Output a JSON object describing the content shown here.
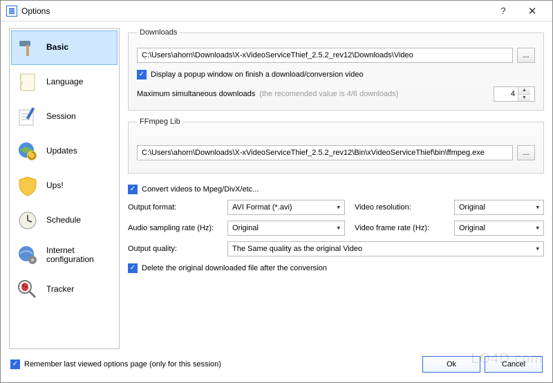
{
  "titlebar": {
    "title": "Options",
    "help": "?",
    "close": "✕"
  },
  "sidebar": {
    "items": [
      {
        "label": "Basic",
        "selected": true
      },
      {
        "label": "Language"
      },
      {
        "label": "Session"
      },
      {
        "label": "Updates"
      },
      {
        "label": "Ups!"
      },
      {
        "label": "Schedule"
      },
      {
        "label": "Internet\nconfiguration"
      },
      {
        "label": "Tracker"
      }
    ]
  },
  "downloads": {
    "legend": "Downloads",
    "path": "C:\\Users\\ahorn\\Downloads\\X-xVideoServiceThief_2.5.2_rev12\\Downloads\\Video",
    "browse": "...",
    "popup_label": "Display a popup window on finish a download/conversion video",
    "maxdl_label": "Maximum simultaneous downloads ",
    "maxdl_hint": "(the recomended value is 4/6 downloads)",
    "maxdl_value": "4"
  },
  "ffmpeg": {
    "legend": "FFmpeg Lib",
    "path": "C:\\Users\\ahorn\\Downloads\\X-xVideoServiceThief_2.5.2_rev12\\Bin\\xVideoServiceThief\\bin\\ffmpeg.exe",
    "browse": "..."
  },
  "convert": {
    "convert_label": "Convert videos to Mpeg/DivX/etc...",
    "output_format_label": "Output format:",
    "output_format_value": "AVI Format (*.avi)",
    "video_resolution_label": "Video resolution:",
    "video_resolution_value": "Original",
    "audio_rate_label": "Audio sampling rate (Hz):",
    "audio_rate_value": "Original",
    "video_frame_label": "Video frame rate (Hz):",
    "video_frame_value": "Original",
    "output_quality_label": "Output quality:",
    "output_quality_value": "The Same quality as the original Video",
    "delete_label": "Delete the original downloaded file after the conversion"
  },
  "footer": {
    "remember_label": "Remember last viewed options page (only for this session)",
    "ok": "Ok",
    "cancel": "Cancel"
  },
  "watermark": "LO4D.com"
}
